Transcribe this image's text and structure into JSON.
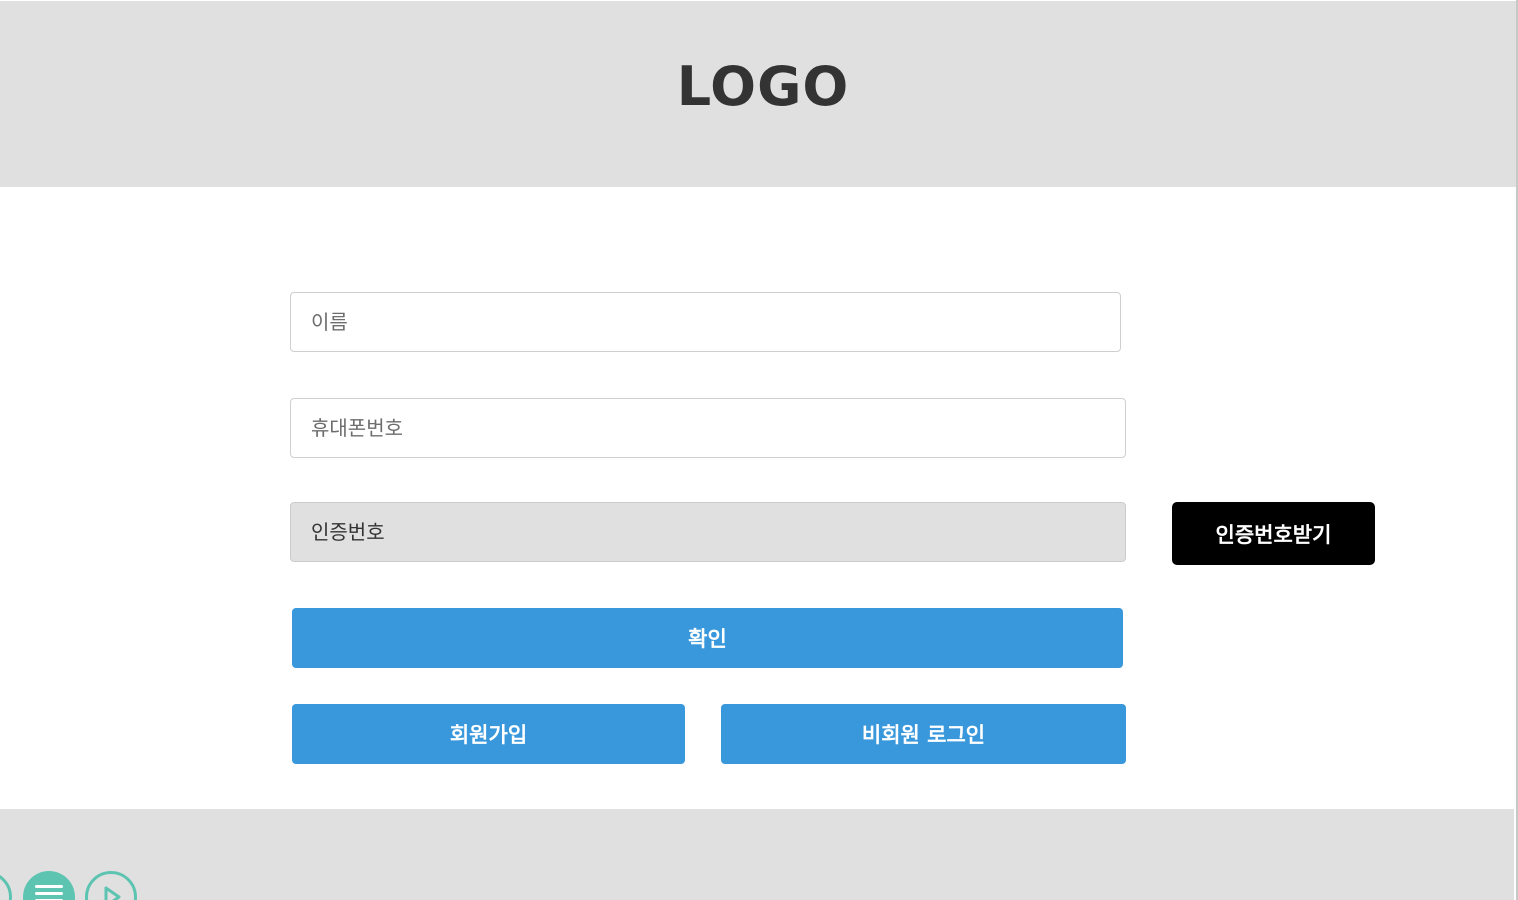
{
  "header": {
    "logo": "LOGO"
  },
  "form": {
    "name_placeholder": "이름",
    "phone_placeholder": "휴대폰번호",
    "code_placeholder": "인증번호",
    "request_code_label": "인증번호받기",
    "confirm_label": "확인",
    "signup_label": "회원가입",
    "guest_login_label": "비회원 로그인"
  },
  "footer": {
    "buttons": [
      {
        "icon": "circle-icon"
      },
      {
        "icon": "menu-icon"
      },
      {
        "icon": "play-icon"
      }
    ]
  },
  "colors": {
    "accent": "#3898db",
    "header_bg": "#e0e0e0",
    "fab": "#5cc4b0"
  }
}
